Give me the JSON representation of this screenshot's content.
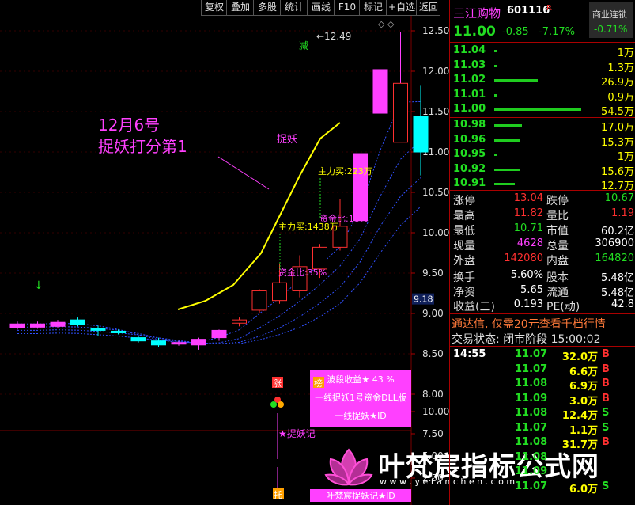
{
  "toolbar": {
    "buttons": [
      "复权",
      "叠加",
      "多股",
      "统计",
      "画线",
      "F10",
      "标记",
      "+自选",
      "返回"
    ]
  },
  "chart": {
    "y_ticks": [
      "12.50",
      "12.00",
      "11.50",
      "11.00",
      "10.50",
      "10.00",
      "9.50",
      "9.00",
      "8.50",
      "8.00"
    ],
    "high_label": "12.49",
    "current_price_tag": "9.18",
    "annotation_title": "12月6号",
    "annotation_sub": "捉妖打分第1",
    "label_jian": "减",
    "label_zhuoyao": "捉妖",
    "label_zhuli_1": "主力买:223万",
    "label_zhuli_2": "主力买:1438万",
    "label_zijin_1": "资金比:18%",
    "label_zijin_2": "资金比:35%",
    "info_box": [
      "波段收益★ 43  %",
      "一线捉妖1号资金DLL版",
      "一线捉妖★ID"
    ],
    "marker_zhang": "涨",
    "marker_bang": "榜",
    "sub_y_ticks": [
      "10.00",
      "7.50",
      "5.00",
      "2.50"
    ],
    "sub_label": "★捉妖记",
    "sub_footer": "叶梵宸捉妖记★ID",
    "sub_marker": "托",
    "watermark_title": "叶梵宸指标公式网",
    "watermark_url": "w w w . y e f a n c h e n . c o m",
    "colors": {
      "up": "#ff40ff",
      "down": "#00ffff",
      "ma": "#ffff00",
      "grid": "#7a0000"
    }
  },
  "chart_data": {
    "type": "candlestick",
    "ylim": [
      7.9,
      12.6
    ],
    "candles": [
      {
        "open": 8.82,
        "close": 8.87,
        "high": 8.9,
        "low": 8.8
      },
      {
        "open": 8.83,
        "close": 8.87,
        "high": 8.9,
        "low": 8.81
      },
      {
        "open": 8.84,
        "close": 8.89,
        "high": 8.92,
        "low": 8.82
      },
      {
        "open": 8.92,
        "close": 8.86,
        "high": 8.95,
        "low": 8.84
      },
      {
        "open": 8.81,
        "close": 8.79,
        "high": 8.85,
        "low": 8.72
      },
      {
        "open": 8.78,
        "close": 8.76,
        "high": 8.8,
        "low": 8.74
      },
      {
        "open": 8.7,
        "close": 8.66,
        "high": 8.72,
        "low": 8.64
      },
      {
        "open": 8.66,
        "close": 8.61,
        "high": 8.7,
        "low": 8.58
      },
      {
        "open": 8.62,
        "close": 8.64,
        "high": 8.66,
        "low": 8.6
      },
      {
        "open": 8.61,
        "close": 8.68,
        "high": 8.7,
        "low": 8.55
      },
      {
        "open": 8.7,
        "close": 8.79,
        "high": 8.8,
        "low": 8.66
      },
      {
        "open": 8.88,
        "close": 8.92,
        "high": 8.95,
        "low": 8.84
      },
      {
        "open": 9.04,
        "close": 9.28,
        "high": 9.3,
        "low": 9.0
      },
      {
        "open": 9.16,
        "close": 9.38,
        "high": 9.62,
        "low": 9.12
      },
      {
        "open": 9.28,
        "close": 9.58,
        "high": 9.72,
        "low": 9.2
      },
      {
        "open": 9.55,
        "close": 9.82,
        "high": 9.86,
        "low": 9.44
      },
      {
        "open": 9.82,
        "close": 10.08,
        "high": 10.42,
        "low": 9.78
      },
      {
        "open": 10.15,
        "close": 10.98,
        "high": 10.98,
        "low": 10.15
      },
      {
        "open": 11.48,
        "close": 12.02,
        "high": 12.02,
        "low": 11.48
      },
      {
        "open": 11.12,
        "close": 11.85,
        "high": 12.49,
        "low": 11.12
      },
      {
        "open": 11.44,
        "close": 11.0,
        "high": 11.82,
        "low": 10.71
      }
    ]
  },
  "panel": {
    "stock_name": "三江购物",
    "stock_code": "601116",
    "stock_flag": "R",
    "sector": "商业连锁",
    "sector_change": "-0.71%",
    "price": "11.00",
    "change": "-0.85",
    "change_pct": "-7.17%",
    "asks": [
      {
        "price": "11.04",
        "vol": "1万",
        "bar": 0.02
      },
      {
        "price": "11.03",
        "vol": "1.3万",
        "bar": 0.02
      },
      {
        "price": "11.02",
        "vol": "26.9万",
        "bar": 0.5
      },
      {
        "price": "11.01",
        "vol": "0.9万",
        "bar": 0.02
      },
      {
        "price": "11.00",
        "vol": "54.5万",
        "bar": 1.0
      }
    ],
    "bids": [
      {
        "price": "10.98",
        "vol": "17.0万",
        "bar": 0.32
      },
      {
        "price": "10.96",
        "vol": "15.3万",
        "bar": 0.29
      },
      {
        "price": "10.95",
        "vol": "1万",
        "bar": 0.02
      },
      {
        "price": "10.92",
        "vol": "15.6万",
        "bar": 0.29
      },
      {
        "price": "10.91",
        "vol": "12.7万",
        "bar": 0.24
      }
    ],
    "stats": [
      {
        "l1": "涨停",
        "v1": "13.04",
        "c1": "red",
        "l2": "跌停",
        "v2": "10.67",
        "c2": "green"
      },
      {
        "l1": "最高",
        "v1": "11.82",
        "c1": "red",
        "l2": "量比",
        "v2": "1.19",
        "c2": "red"
      },
      {
        "l1": "最低",
        "v1": "10.71",
        "c1": "green",
        "l2": "市值",
        "v2": "60.2亿",
        "c2": "white"
      },
      {
        "l1": "现量",
        "v1": "4628",
        "c1": "magenta",
        "l2": "总量",
        "v2": "306900",
        "c2": "white"
      },
      {
        "l1": "外盘",
        "v1": "142080",
        "c1": "red",
        "l2": "内盘",
        "v2": "164820",
        "c2": "green"
      }
    ],
    "stats2": [
      {
        "l1": "换手",
        "v1": "5.60%",
        "l2": "股本",
        "v2": "5.48亿"
      },
      {
        "l1": "净资",
        "v1": "5.65",
        "l2": "流通",
        "v2": "5.48亿"
      },
      {
        "l1": "收益(三)",
        "v1": "0.193",
        "l2": "PE(动)",
        "v2": "42.8"
      }
    ],
    "promo": "通达信, 仅需20元查看千档行情",
    "trade_status": "交易状态: 闭市阶段 15:00:02",
    "trades": [
      {
        "time": "14:55",
        "price": "11.07",
        "vol": "32.0万",
        "side": "B"
      },
      {
        "time": "",
        "price": "11.07",
        "vol": "6.6万",
        "side": "B"
      },
      {
        "time": "",
        "price": "11.08",
        "vol": "6.9万",
        "side": "B"
      },
      {
        "time": "",
        "price": "11.09",
        "vol": "3.0万",
        "side": "B"
      },
      {
        "time": "",
        "price": "11.08",
        "vol": "12.4万",
        "side": "S"
      },
      {
        "time": "",
        "price": "11.07",
        "vol": "1.1万",
        "side": "S"
      },
      {
        "time": "",
        "price": "11.08",
        "vol": "31.7万",
        "side": "B"
      },
      {
        "time": "",
        "price": "11.08",
        "vol": "",
        "side": ""
      },
      {
        "time": "",
        "price": "11.09",
        "vol": "",
        "side": ""
      },
      {
        "time": "",
        "price": "11.07",
        "vol": "6.0万",
        "side": "S"
      }
    ]
  }
}
